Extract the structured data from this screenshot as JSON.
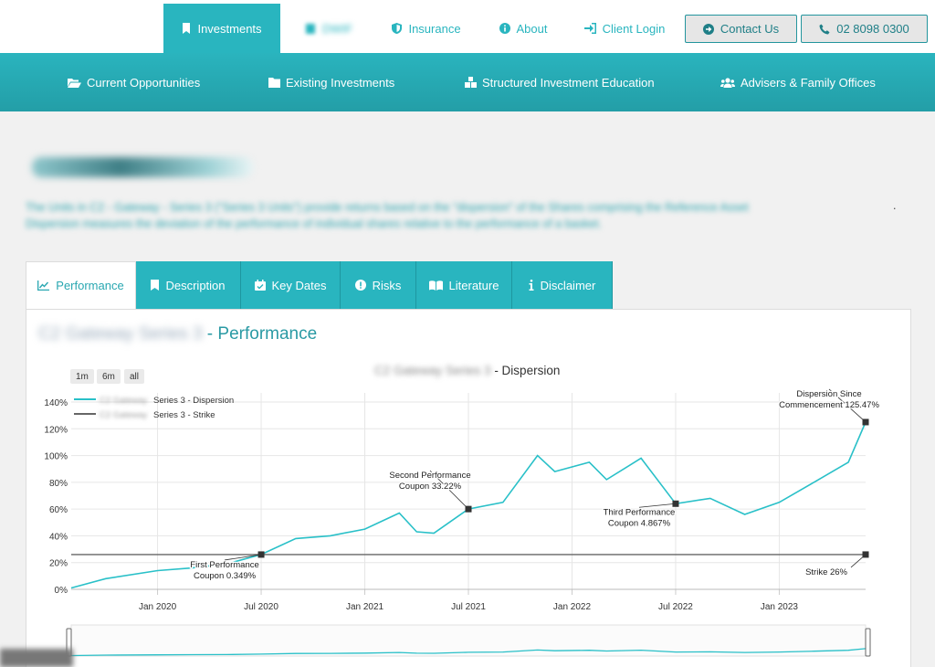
{
  "topnav": {
    "items": [
      {
        "label": "Investments",
        "icon": "bookmark-icon"
      },
      {
        "label": "DWIF",
        "icon": "building-icon"
      },
      {
        "label": "Insurance",
        "icon": "shield-icon"
      },
      {
        "label": "About",
        "icon": "info-icon"
      },
      {
        "label": "Client Login",
        "icon": "login-icon"
      }
    ],
    "contact_label": "Contact Us",
    "phone_label": "02 8098 0300"
  },
  "subnav": {
    "items": [
      {
        "label": "Current Opportunities",
        "icon": "folder-open-icon"
      },
      {
        "label": "Existing Investments",
        "icon": "folder-icon"
      },
      {
        "label": "Structured Investment Education",
        "icon": "cubes-icon"
      },
      {
        "label": "Advisers & Family Offices",
        "icon": "users-icon"
      }
    ]
  },
  "description": {
    "line1": "The Units in C2 - Gateway - Series 3 (\"Series 3 Units\") provide returns based on the \"dispersion\" of the Shares comprising the Reference Asset",
    "line1_end": ".",
    "line2": "Dispersion measures the deviation of the performance of individual shares relative to the performance of a basket."
  },
  "tabs": [
    {
      "label": "Performance",
      "icon": "line-chart-icon"
    },
    {
      "label": "Description",
      "icon": "bookmark-icon"
    },
    {
      "label": "Key Dates",
      "icon": "calendar-check-icon"
    },
    {
      "label": "Risks",
      "icon": "exclamation-icon"
    },
    {
      "label": "Literature",
      "icon": "book-icon"
    },
    {
      "label": "Disclaimer",
      "icon": "info-icon"
    }
  ],
  "section": {
    "title_blurred": "C2 Gateway Series 3",
    "title_suffix": " - Performance"
  },
  "range_buttons": [
    "1m",
    "6m",
    "all"
  ],
  "chart_data": {
    "type": "line",
    "title_blurred": "C2 Gateway Series 3",
    "title_suffix": " - Dispersion",
    "ylim": [
      0,
      140
    ],
    "yticks": [
      0,
      20,
      40,
      60,
      80,
      100,
      120,
      140
    ],
    "ytick_labels": [
      "0%",
      "20%",
      "40%",
      "60%",
      "80%",
      "100%",
      "120%",
      "140%"
    ],
    "xticks": [
      {
        "x": "2020-01",
        "label": "Jan 2020"
      },
      {
        "x": "2020-07",
        "label": "Jul 2020"
      },
      {
        "x": "2021-01",
        "label": "Jan 2021"
      },
      {
        "x": "2021-07",
        "label": "Jul 2021"
      },
      {
        "x": "2022-01",
        "label": "Jan 2022"
      },
      {
        "x": "2022-07",
        "label": "Jul 2022"
      },
      {
        "x": "2023-01",
        "label": "Jan 2023"
      }
    ],
    "legend": [
      {
        "blurred": "C2 Gateway",
        "name": "Series 3 - Dispersion",
        "color": "#29c0c8"
      },
      {
        "blurred": "C2 Gateway",
        "name": "Series 3 - Strike",
        "color": "#666666"
      }
    ],
    "series": [
      {
        "name": "Series 3 - Dispersion",
        "color": "#29c0c8",
        "x": [
          "2019-08",
          "2019-10",
          "2020-01",
          "2020-03",
          "2020-05",
          "2020-07",
          "2020-09",
          "2020-11",
          "2021-01",
          "2021-03",
          "2021-04",
          "2021-05",
          "2021-07",
          "2021-09",
          "2021-11",
          "2021-12",
          "2022-02",
          "2022-03",
          "2022-05",
          "2022-07",
          "2022-09",
          "2022-11",
          "2023-01",
          "2023-03",
          "2023-05",
          "2023-06"
        ],
        "values": [
          1,
          8,
          14,
          16,
          19,
          26,
          38,
          40,
          45,
          57,
          43,
          42,
          60,
          65,
          100,
          88,
          95,
          82,
          98,
          64,
          68,
          56,
          65,
          80,
          95,
          125
        ]
      },
      {
        "name": "Series 3 - Strike",
        "color": "#666666",
        "x": [
          "2019-08",
          "2023-06"
        ],
        "values": [
          26,
          26
        ]
      }
    ],
    "annotations": [
      {
        "x": "2020-07",
        "y": 26,
        "text": [
          "First Performance",
          "Coupon 0.349%"
        ]
      },
      {
        "x": "2021-07",
        "y": 60,
        "text": [
          "Second Performance",
          "Coupon 33.22%"
        ]
      },
      {
        "x": "2022-07",
        "y": 64,
        "text": [
          "Third Performance",
          "Coupon 4.867%"
        ]
      },
      {
        "x": "2023-06",
        "y": 125,
        "text": [
          "Dispersion Since",
          "Commencement 125.47%"
        ]
      },
      {
        "x": "2023-06",
        "y": 26,
        "text": [
          "Strike 26%"
        ]
      }
    ]
  }
}
